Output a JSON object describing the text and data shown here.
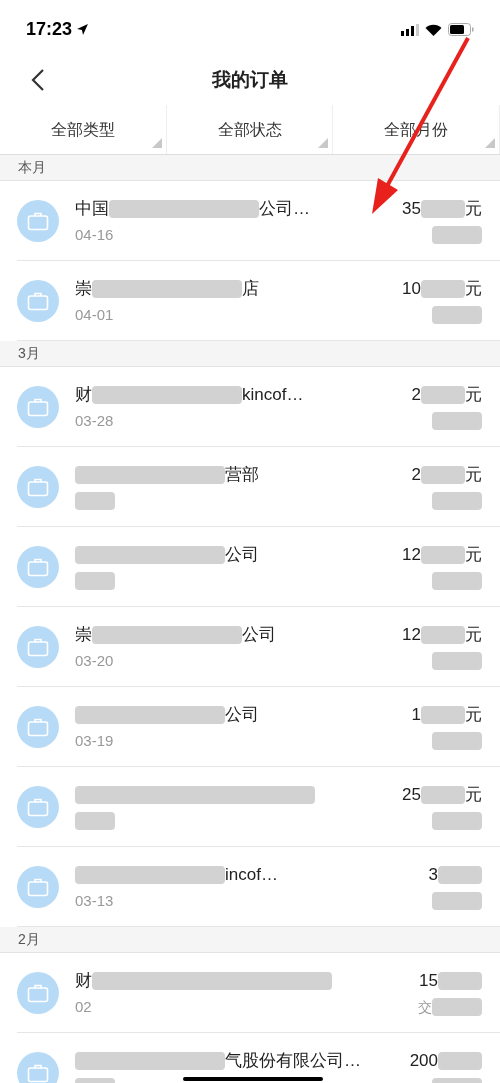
{
  "status_bar": {
    "time": "17:23"
  },
  "nav": {
    "title": "我的订单"
  },
  "filters": [
    {
      "label": "全部类型"
    },
    {
      "label": "全部状态"
    },
    {
      "label": "全部月份"
    }
  ],
  "sections": [
    {
      "title": "本月",
      "orders": [
        {
          "title_start": "中国",
          "title_end": "公司…",
          "date": "04-16",
          "amount": "35",
          "unit": "元"
        },
        {
          "title_start": "崇",
          "title_end": "店",
          "date": "04-01",
          "amount": "10",
          "unit": "元"
        }
      ]
    },
    {
      "title": "3月",
      "orders": [
        {
          "title_start": "财",
          "title_end": "kincof…",
          "date": "03-28",
          "amount": "2",
          "unit": "元"
        },
        {
          "title_end": "营部",
          "amount": "2",
          "unit": "元"
        },
        {
          "title_end": "公司",
          "amount": "12",
          "unit": "元"
        },
        {
          "title_start": "崇",
          "title_end": "公司",
          "date": "03-20",
          "amount": "12",
          "unit": "元"
        },
        {
          "title_end": "公司",
          "date": "03-19",
          "amount": "1",
          "unit": "元"
        },
        {
          "amount": "25",
          "unit": "元"
        },
        {
          "title_end": "incof…",
          "date": "03-13",
          "amount": "3"
        }
      ]
    },
    {
      "title": "2月",
      "orders": [
        {
          "title_start": "财",
          "date": "02",
          "amount": "15",
          "status": "交"
        },
        {
          "title_end": "气股份有限公司…",
          "amount": "200"
        }
      ]
    }
  ]
}
